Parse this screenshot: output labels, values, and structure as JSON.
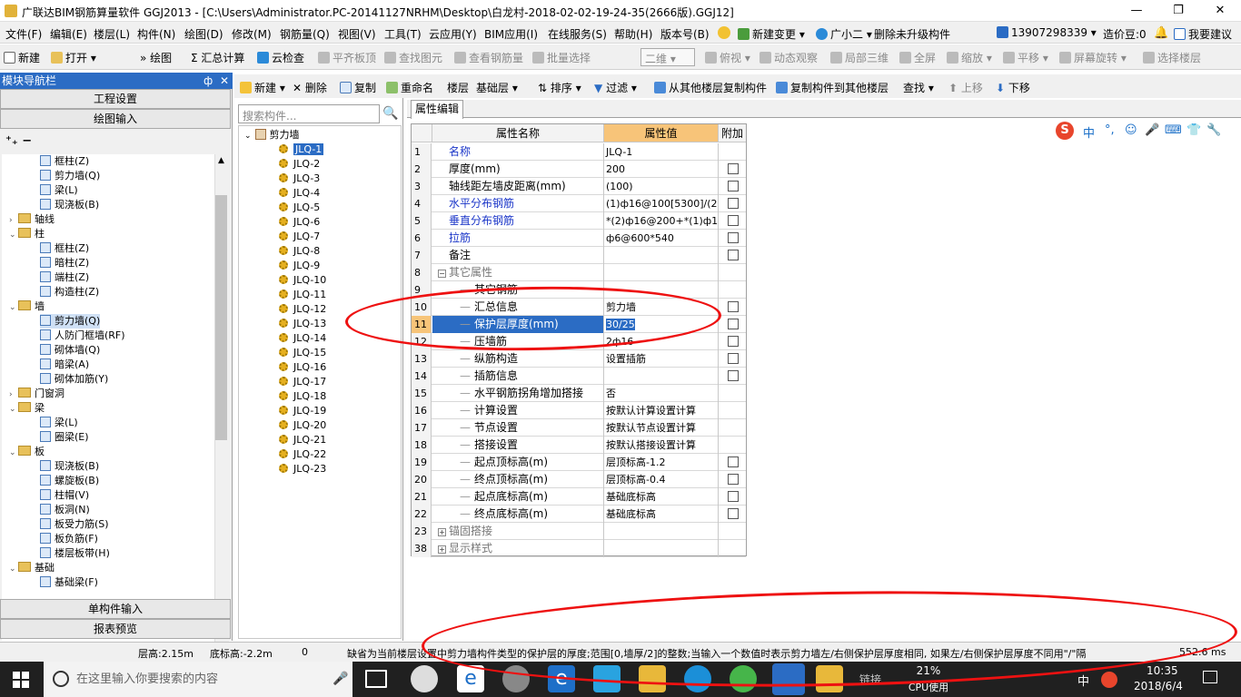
{
  "window": {
    "title": "广联达BIM钢筋算量软件 GGJ2013 - [C:\\Users\\Administrator.PC-20141127NRHM\\Desktop\\白龙村-2018-02-02-19-24-35(2666版).GGJ12]",
    "min": "—",
    "max": "❐",
    "close": "✕"
  },
  "menu": [
    "文件(F)",
    "编辑(E)",
    "楼层(L)",
    "构件(N)",
    "绘图(D)",
    "修改(M)",
    "钢筋量(Q)",
    "视图(V)",
    "工具(T)",
    "云应用(Y)",
    "BIM应用(I)",
    "在线服务(S)",
    "帮助(H)",
    "版本号(B)"
  ],
  "menu_right": {
    "change": "新建变更",
    "assistant": "广小二",
    "delete_unupgraded": "删除未升级构件",
    "phone": "13907298339",
    "bean": "造价豆:0",
    "suggest": "我要建议"
  },
  "toolbar1": {
    "new": "新建",
    "open": "打开",
    "draw": "绘图",
    "sum": "汇总计算",
    "cloud_check": "云检查",
    "flatten": "平齐板顶",
    "find": "查找图元",
    "view_rebar": "查看钢筋量",
    "batch": "批量选择",
    "view2d": "二维",
    "top_view": "俯视",
    "dynamic": "动态观察",
    "local3d": "局部三维",
    "fullscreen": "全屏",
    "zoom": "缩放",
    "pan": "平移",
    "rotate": "屏幕旋转",
    "select_floor": "选择楼层"
  },
  "left_panel": {
    "header": "模块导航栏",
    "pin": "ф",
    "close": "✕",
    "btn_project": "工程设置",
    "btn_draw": "绘图输入",
    "btn_single": "单构件输入",
    "btn_report": "报表预览",
    "tree": [
      {
        "label": "框柱(Z)",
        "level": 2
      },
      {
        "label": "剪力墙(Q)",
        "level": 2
      },
      {
        "label": "梁(L)",
        "level": 2
      },
      {
        "label": "现浇板(B)",
        "level": 2
      },
      {
        "label": "轴线",
        "level": 0,
        "folder": true,
        "collapsed": true
      },
      {
        "label": "柱",
        "level": 0,
        "folder": true
      },
      {
        "label": "框柱(Z)",
        "level": 2
      },
      {
        "label": "暗柱(Z)",
        "level": 2
      },
      {
        "label": "端柱(Z)",
        "level": 2
      },
      {
        "label": "构造柱(Z)",
        "level": 2
      },
      {
        "label": "墙",
        "level": 0,
        "folder": true
      },
      {
        "label": "剪力墙(Q)",
        "level": 2,
        "selected": true
      },
      {
        "label": "人防门框墙(RF)",
        "level": 2
      },
      {
        "label": "砌体墙(Q)",
        "level": 2
      },
      {
        "label": "暗梁(A)",
        "level": 2
      },
      {
        "label": "砌体加筋(Y)",
        "level": 2
      },
      {
        "label": "门窗洞",
        "level": 0,
        "folder": true,
        "collapsed": true
      },
      {
        "label": "梁",
        "level": 0,
        "folder": true
      },
      {
        "label": "梁(L)",
        "level": 2
      },
      {
        "label": "圈梁(E)",
        "level": 2
      },
      {
        "label": "板",
        "level": 0,
        "folder": true
      },
      {
        "label": "现浇板(B)",
        "level": 2
      },
      {
        "label": "螺旋板(B)",
        "level": 2
      },
      {
        "label": "柱帽(V)",
        "level": 2
      },
      {
        "label": "板洞(N)",
        "level": 2
      },
      {
        "label": "板受力筋(S)",
        "level": 2
      },
      {
        "label": "板负筋(F)",
        "level": 2
      },
      {
        "label": "楼层板带(H)",
        "level": 2
      },
      {
        "label": "基础",
        "level": 0,
        "folder": true
      },
      {
        "label": "基础梁(F)",
        "level": 2
      }
    ]
  },
  "toolbar2": {
    "new": "新建",
    "delete": "删除",
    "copy": "复制",
    "rename": "重命名",
    "floor_label": "楼层",
    "floor_value": "基础层",
    "sort": "排序",
    "filter": "过滤",
    "copy_from": "从其他楼层复制构件",
    "copy_to": "复制构件到其他楼层",
    "search": "查找",
    "up": "上移",
    "down": "下移"
  },
  "component_list": {
    "search_placeholder": "搜索构件...",
    "root": "剪力墙",
    "items": [
      "JLQ-1",
      "JLQ-2",
      "JLQ-3",
      "JLQ-4",
      "JLQ-5",
      "JLQ-6",
      "JLQ-7",
      "JLQ-8",
      "JLQ-9",
      "JLQ-10",
      "JLQ-11",
      "JLQ-12",
      "JLQ-13",
      "JLQ-14",
      "JLQ-15",
      "JLQ-16",
      "JLQ-17",
      "JLQ-18",
      "JLQ-19",
      "JLQ-20",
      "JLQ-21",
      "JLQ-22",
      "JLQ-23"
    ],
    "selected": "JLQ-1"
  },
  "props": {
    "tab": "属性编辑",
    "col_name": "属性名称",
    "col_value": "属性值",
    "col_extra": "附加",
    "rows": [
      {
        "n": "1",
        "name": "名称",
        "value": "JLQ-1",
        "blue": true,
        "chk": false,
        "indent": 0
      },
      {
        "n": "2",
        "name": "厚度(mm)",
        "value": "200",
        "chk": true,
        "indent": 0
      },
      {
        "n": "3",
        "name": "轴线距左墙皮距离(mm)",
        "value": "(100)",
        "chk": true,
        "indent": 0
      },
      {
        "n": "4",
        "name": "水平分布钢筋",
        "value": "(1)ф16@100[5300]/(2",
        "blue": true,
        "chk": true,
        "indent": 0
      },
      {
        "n": "5",
        "name": "垂直分布钢筋",
        "value": "*(2)ф16@200+*(1)ф1",
        "blue": true,
        "chk": true,
        "indent": 0
      },
      {
        "n": "6",
        "name": "拉筋",
        "value": "ф6@600*540",
        "blue": true,
        "chk": true,
        "indent": 0
      },
      {
        "n": "7",
        "name": "备注",
        "value": "",
        "chk": true,
        "indent": 0
      },
      {
        "n": "8",
        "name": "其它属性",
        "value": "",
        "chk": false,
        "indent": 0,
        "group": true,
        "sign": "−"
      },
      {
        "n": "9",
        "name": "其它钢筋",
        "value": "",
        "chk": false,
        "indent": 1
      },
      {
        "n": "10",
        "name": "汇总信息",
        "value": "剪力墙",
        "chk": true,
        "indent": 1
      },
      {
        "n": "11",
        "name": "保护层厚度(mm)",
        "value": "30/25",
        "chk": true,
        "indent": 1,
        "selected": true
      },
      {
        "n": "12",
        "name": "压墙筋",
        "value": "2ф16",
        "chk": true,
        "indent": 1
      },
      {
        "n": "13",
        "name": "纵筋构造",
        "value": "设置插筋",
        "chk": true,
        "indent": 1
      },
      {
        "n": "14",
        "name": "插筋信息",
        "value": "",
        "chk": true,
        "indent": 1
      },
      {
        "n": "15",
        "name": "水平钢筋拐角增加搭接",
        "value": "否",
        "chk": false,
        "indent": 1
      },
      {
        "n": "16",
        "name": "计算设置",
        "value": "按默认计算设置计算",
        "chk": false,
        "indent": 1
      },
      {
        "n": "17",
        "name": "节点设置",
        "value": "按默认节点设置计算",
        "chk": false,
        "indent": 1
      },
      {
        "n": "18",
        "name": "搭接设置",
        "value": "按默认搭接设置计算",
        "chk": false,
        "indent": 1
      },
      {
        "n": "19",
        "name": "起点顶标高(m)",
        "value": "层顶标高-1.2",
        "chk": true,
        "indent": 1
      },
      {
        "n": "20",
        "name": "终点顶标高(m)",
        "value": "层顶标高-0.4",
        "chk": true,
        "indent": 1
      },
      {
        "n": "21",
        "name": "起点底标高(m)",
        "value": "基础底标高",
        "chk": true,
        "indent": 1
      },
      {
        "n": "22",
        "name": "终点底标高(m)",
        "value": "基础底标高",
        "chk": true,
        "indent": 1
      },
      {
        "n": "23",
        "name": "锚固搭接",
        "value": "",
        "chk": false,
        "indent": 0,
        "group": true,
        "sign": "+"
      },
      {
        "n": "38",
        "name": "显示样式",
        "value": "",
        "chk": false,
        "indent": 0,
        "group": true,
        "sign": "+"
      }
    ]
  },
  "ime": {
    "s": "S",
    "zh": "中",
    "punct": "°,",
    "smile": "☺",
    "mic": "🎤",
    "kb": "⌨",
    "skin": "👕",
    "tool": "🔧"
  },
  "status": {
    "floor_height": "层高:2.15m",
    "bottom_elev": "底标高:-2.2m",
    "zero": "0",
    "hint": "缺省为当前楼层设置中剪力墙构件类型的保护层的厚度;范围[0,墙厚/2]的整数;当输入一个数值时表示剪力墙左/右侧保护层厚度相同, 如果左/右侧保护层厚度不同用\"/\"隔",
    "coord": "552.6 ms"
  },
  "taskbar": {
    "search": "在这里输入你要搜索的内容",
    "cpu_pct": "21%",
    "cpu_label": "CPU使用",
    "link": "链接",
    "lang": "中",
    "time": "10:35",
    "date": "2018/6/4"
  }
}
